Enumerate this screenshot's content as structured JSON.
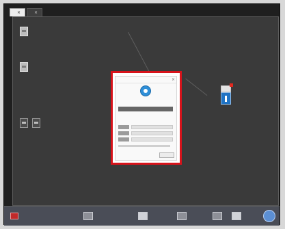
{
  "tabs": [
    {
      "label": "",
      "active": true
    },
    {
      "label": "",
      "active": false
    }
  ],
  "dialog": {
    "title": "",
    "brand": ""
  },
  "colors": {
    "selection": "#d8131b",
    "canvas": "#3a3a3a",
    "bottom_bar": "#4a4d57",
    "logo": "#2f8fd8"
  },
  "icons": {
    "left_nodes": [
      "document-node-icon",
      "document-node-icon",
      "panel-node-icon",
      "panel-node-icon"
    ],
    "right_node": "info-node-icon",
    "bottom_bar": [
      "alert-icon",
      "grid-icon",
      "grid-icon",
      "grid-icon",
      "grid-icon",
      "grid-icon",
      "help-icon"
    ]
  }
}
